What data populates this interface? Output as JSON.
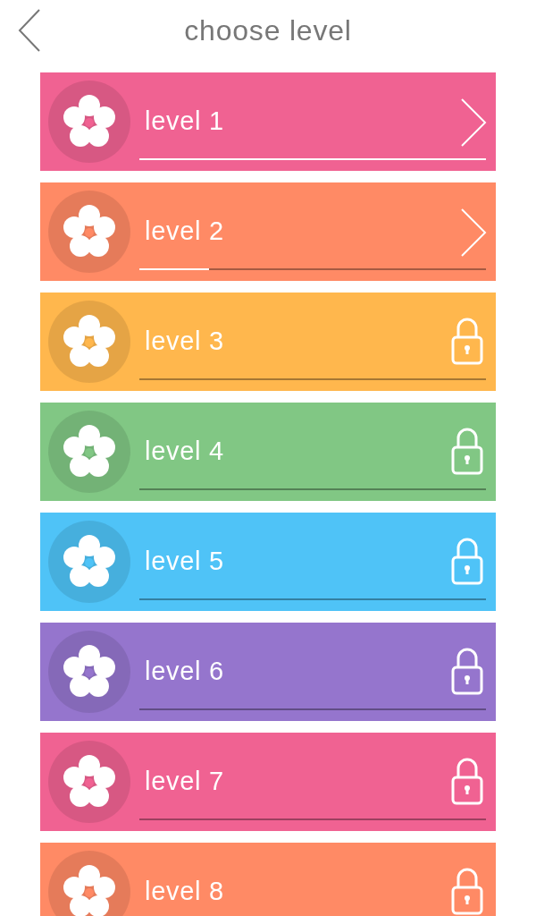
{
  "header": {
    "title": "choose level"
  },
  "levels": [
    {
      "label": "level 1",
      "color": "#f06292",
      "locked": false,
      "level": 1
    },
    {
      "label": "level 2",
      "color": "#ff8a65",
      "locked": false,
      "level": 0.2
    },
    {
      "label": "level 3",
      "color": "#ffb74d",
      "locked": true,
      "level": 0
    },
    {
      "label": "level 4",
      "color": "#81c784",
      "locked": true,
      "level": 0
    },
    {
      "label": "level 5",
      "color": "#4fc3f7",
      "locked": true,
      "level": 0
    },
    {
      "label": "level 6",
      "color": "#9575cd",
      "locked": true,
      "level": 0
    },
    {
      "label": "level 7",
      "color": "#f06292",
      "locked": true,
      "level": 0
    },
    {
      "label": "level 8",
      "color": "#ff8a65",
      "locked": true
    }
  ]
}
